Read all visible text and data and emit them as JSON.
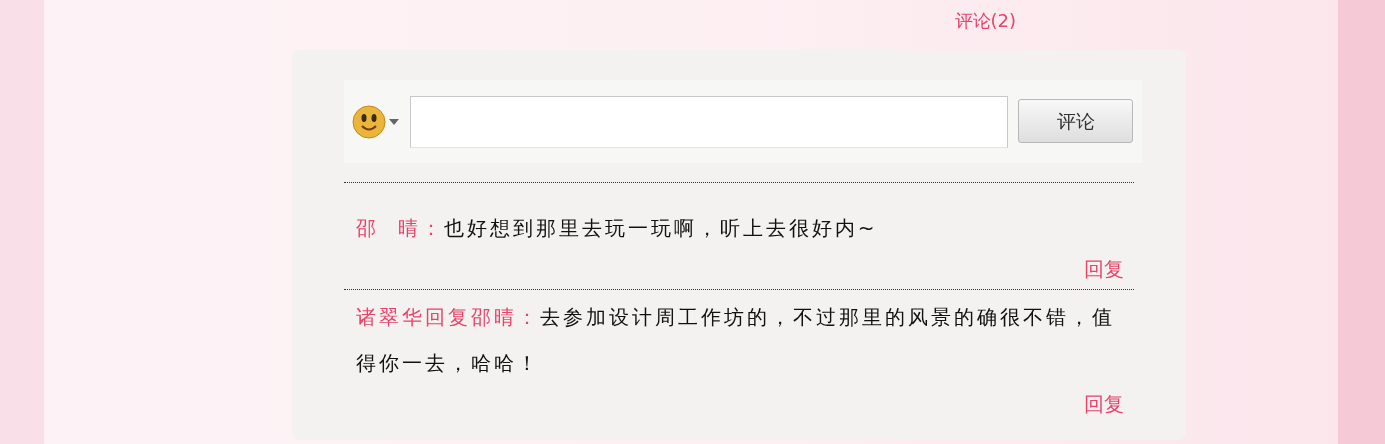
{
  "comments_link": "评论(2)",
  "comment_form": {
    "submit": "评论"
  },
  "comments": [
    {
      "author": "邵  晴：",
      "text": "也好想到那里去玩一玩啊，听上去很好内~",
      "reply": "回复"
    },
    {
      "author": "诸翠华回复邵晴：",
      "text": "去参加设计周工作坊的，不过那里的风景的确很不错，值得你一去，哈哈！",
      "reply": "回复"
    }
  ]
}
